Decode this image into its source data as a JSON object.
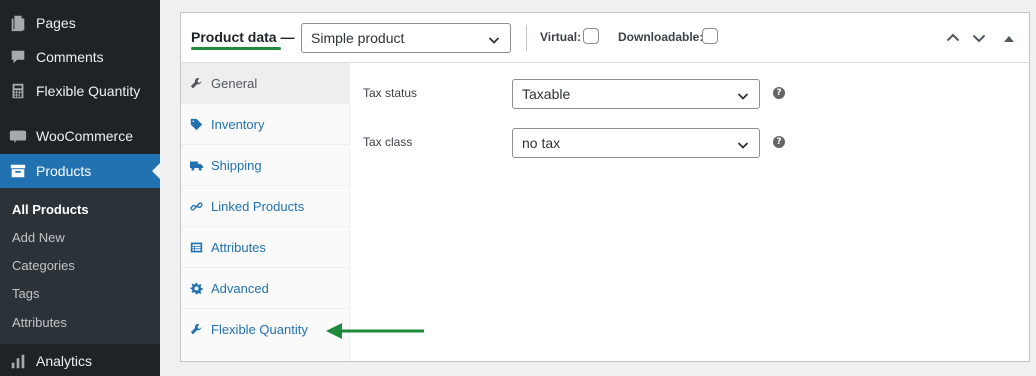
{
  "sidebar": {
    "items": [
      {
        "label": "Pages",
        "icon": "pages-icon"
      },
      {
        "label": "Comments",
        "icon": "comments-icon"
      },
      {
        "label": "Flexible Quantity",
        "icon": "calculator-icon"
      },
      {
        "label": "WooCommerce",
        "icon": "woo-icon"
      },
      {
        "label": "Products",
        "icon": "archive-icon"
      },
      {
        "label": "Analytics",
        "icon": "bar-chart-icon"
      }
    ],
    "submenu": [
      "All Products",
      "Add New",
      "Categories",
      "Tags",
      "Attributes"
    ],
    "current_submenu": "All Products"
  },
  "product_data": {
    "title": "Product data —",
    "product_type": {
      "selected": "Simple product"
    },
    "virtual_label": "Virtual:",
    "virtual_checked": false,
    "downloadable_label": "Downloadable:",
    "downloadable_checked": false,
    "tabs": [
      {
        "label": "General",
        "icon": "wrench-icon"
      },
      {
        "label": "Inventory",
        "icon": "tag-icon"
      },
      {
        "label": "Shipping",
        "icon": "truck-icon"
      },
      {
        "label": "Linked Products",
        "icon": "link-icon"
      },
      {
        "label": "Attributes",
        "icon": "list-icon"
      },
      {
        "label": "Advanced",
        "icon": "gear-icon"
      },
      {
        "label": "Flexible Quantity",
        "icon": "wrench-icon"
      }
    ],
    "active_tab": "General",
    "fields": [
      {
        "label": "Tax status",
        "value": "Taxable"
      },
      {
        "label": "Tax class",
        "value": "no tax"
      }
    ]
  },
  "colors": {
    "admin_bg": "#1d2327",
    "submenu_bg": "#2c3338",
    "accent": "#2271b1",
    "annotation": "#1f8a3b"
  }
}
